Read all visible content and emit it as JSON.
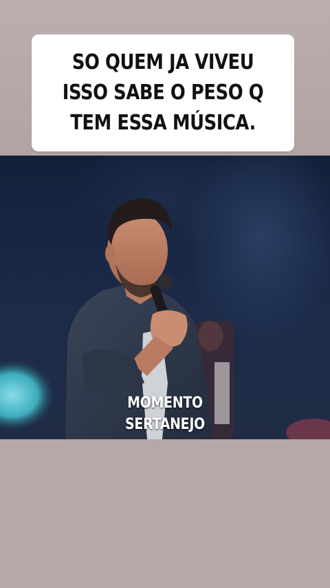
{
  "caption": {
    "text": "SO QUEM JA VIVEU\nISSO SABE  O PESO Q\nTEM ESSA MÚSICA."
  },
  "video": {
    "overlay_line1": "MOMENTO",
    "overlay_line2": "SERTANEJO"
  },
  "colors": {
    "background": "#b6a8a8",
    "caption_bg": "#ffffff",
    "caption_text": "#111111",
    "stage_dark": "#14203a",
    "shirt": "#2f3a4c"
  }
}
